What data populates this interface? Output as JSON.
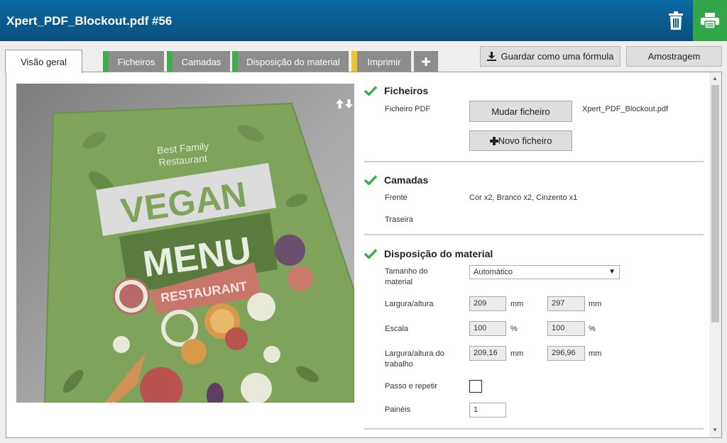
{
  "window": {
    "title": "Xpert_PDF_Blockout.pdf #56"
  },
  "icons": {
    "trash": "trash-icon",
    "print": "printer-icon",
    "add": "plus-icon",
    "download": "download-icon",
    "check": "check-icon"
  },
  "tabs": [
    {
      "label": "Visão geral",
      "status_color": ""
    },
    {
      "label": "Ficheiros",
      "status_color": "#3fae49"
    },
    {
      "label": "Camadas",
      "status_color": "#3fae49"
    },
    {
      "label": "Disposição do material",
      "status_color": "#3fae49"
    },
    {
      "label": "Imprimir",
      "status_color": "#f2c12e"
    }
  ],
  "toolbar": {
    "save_formula": "Guardar como uma fórmula",
    "sample": "Amostragem"
  },
  "preview": {
    "menu_subtitle_line1": "Best Family",
    "menu_subtitle_line2": "Restaurant",
    "menu_word1": "VEGAN",
    "menu_word2": "MENU",
    "menu_word3": "RESTAURANT"
  },
  "files": {
    "heading": "Ficheiros",
    "pdf_label": "Ficheiro PDF",
    "change_button": "Mudar ficheiro",
    "filename": "Xpert_PDF_Blockout.pdf",
    "new_button": "Novo ficheiro"
  },
  "layers": {
    "heading": "Camadas",
    "front_label": "Frente",
    "front_value": "Cor x2, Branco x2, Cinzento x1",
    "back_label": "Traseira"
  },
  "layout": {
    "heading": "Disposição do material",
    "media_size_label_1": "Tamanho do",
    "media_size_label_2": "material",
    "media_size_value": "Automático",
    "width_height_label": "Largura/altura",
    "width": "209",
    "height": "297",
    "unit_mm": "mm",
    "scale_label": "Escala",
    "scale_x": "100",
    "scale_y": "100",
    "unit_pct": "%",
    "job_size_label_1": "Largura/altura do",
    "job_size_label_2": "trabalho",
    "job_width": "209,16",
    "job_height": "296,96",
    "step_repeat_label": "Passo e repetir",
    "step_repeat_checked": false,
    "panels_label": "Painéis",
    "panels_value": "1"
  },
  "colors": {
    "accent_green": "#33a64a",
    "title_blue": "#0a5a8c",
    "check_green": "#3fae49"
  }
}
